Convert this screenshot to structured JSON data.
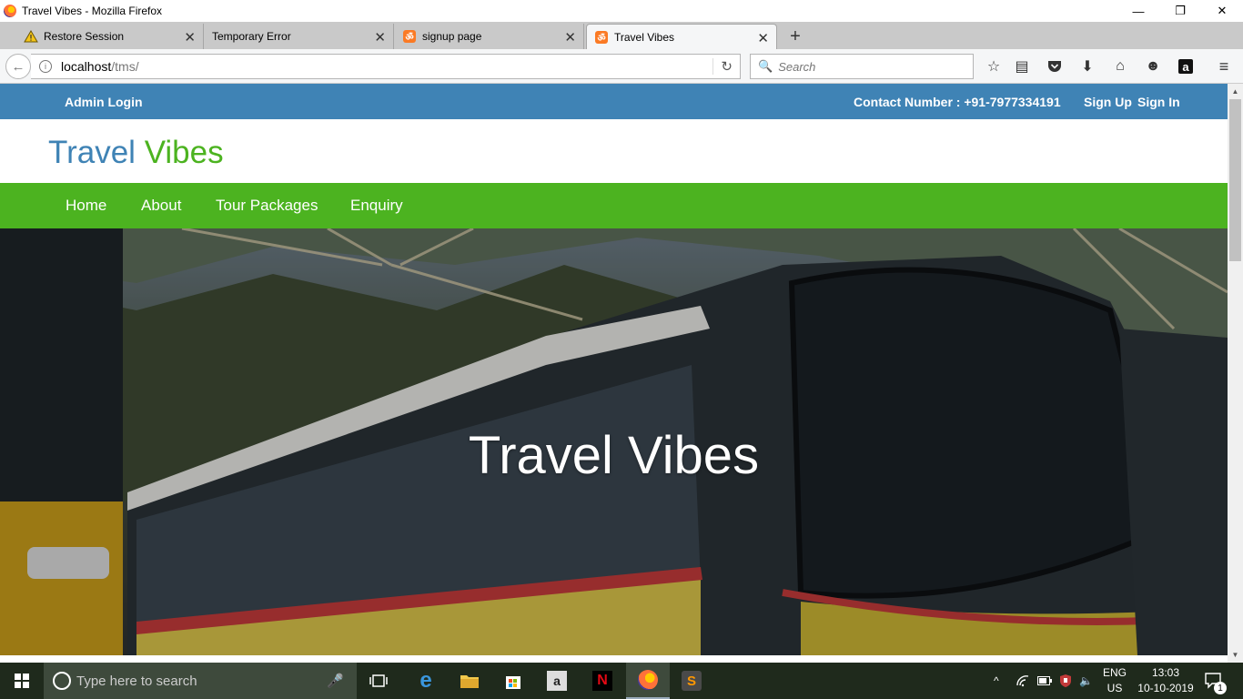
{
  "window": {
    "title": "Travel Vibes - Mozilla Firefox",
    "minimize": "—",
    "maximize": "❐",
    "close": "✕"
  },
  "tabs": [
    {
      "label": "Restore Session",
      "icon": "warning-icon"
    },
    {
      "label": "Temporary Error",
      "icon": "none"
    },
    {
      "label": "signup page",
      "icon": "xampp-icon"
    },
    {
      "label": "Travel Vibes",
      "icon": "xampp-icon",
      "active": true
    }
  ],
  "toolbar": {
    "url_host": "localhost",
    "url_path": "/tms/",
    "search_placeholder": "Search"
  },
  "site": {
    "admin_login": "Admin Login",
    "contact": "Contact Number : +91-7977334191",
    "sign_up": "Sign Up",
    "sign_in": "Sign In",
    "brand_part1": "Travel",
    "brand_part2": "Vibes",
    "menu": [
      "Home",
      "About",
      "Tour Packages",
      "Enquiry"
    ],
    "hero_title": "Travel Vibes",
    "colors": {
      "topbar": "#3f83b5",
      "menubar": "#4cb320",
      "brand_blue": "#3f83b5",
      "brand_green": "#4cb320"
    }
  },
  "taskbar": {
    "search_placeholder": "Type here to search",
    "lang_top": "ENG",
    "lang_bottom": "US",
    "time": "13:03",
    "date": "10-10-2019",
    "notification_count": "1"
  }
}
